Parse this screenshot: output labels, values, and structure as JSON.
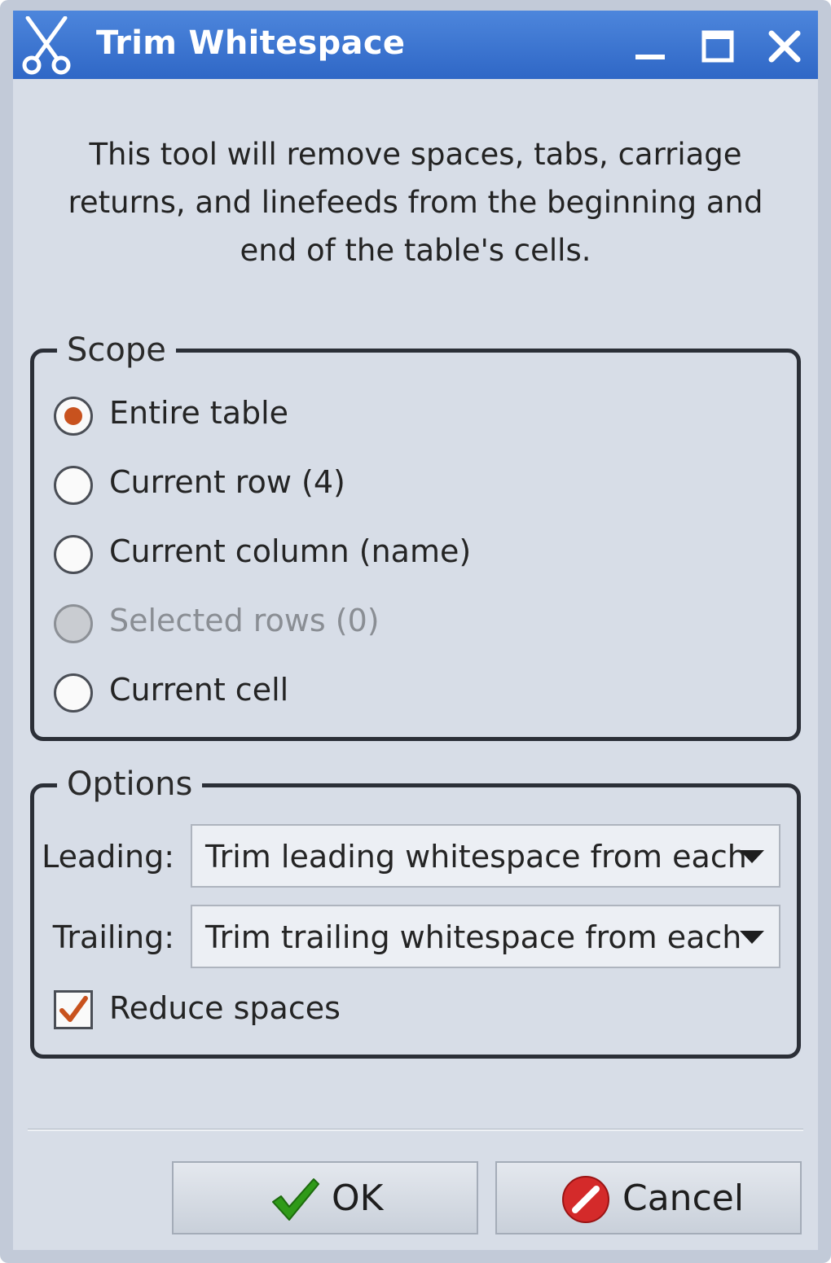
{
  "window": {
    "title": "Trim Whitespace",
    "icon": "scissors-icon"
  },
  "description": "This tool will remove spaces, tabs, carriage returns, and linefeeds from the beginning and end of the table's cells.",
  "scope": {
    "title": "Scope",
    "options": [
      {
        "label": "Entire table",
        "checked": true,
        "enabled": true
      },
      {
        "label": "Current row (4)",
        "checked": false,
        "enabled": true
      },
      {
        "label": "Current column (name)",
        "checked": false,
        "enabled": true
      },
      {
        "label": "Selected rows (0)",
        "checked": false,
        "enabled": false
      },
      {
        "label": "Current cell",
        "checked": false,
        "enabled": true
      }
    ]
  },
  "options": {
    "title": "Options",
    "leading_label": "Leading:",
    "leading_value": "Trim leading whitespace from each",
    "trailing_label": "Trailing:",
    "trailing_value": "Trim trailing whitespace from each",
    "reduce_spaces_label": "Reduce spaces",
    "reduce_spaces_checked": true
  },
  "buttons": {
    "ok_label": "OK",
    "cancel_label": "Cancel"
  },
  "colors": {
    "titlebar": "#3a73d2",
    "accent": "#c8521e",
    "ok_check": "#2f9a18",
    "cancel_red": "#d42a2a"
  }
}
